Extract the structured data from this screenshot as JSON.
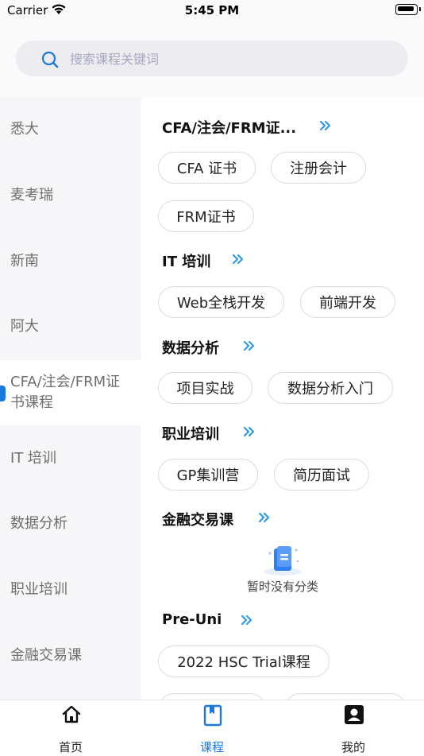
{
  "status_bar": {
    "carrier": "Carrier",
    "time": "5:45 PM"
  },
  "search": {
    "placeholder": "搜索课程关键词"
  },
  "sidebar": {
    "items": [
      {
        "label": "悉大"
      },
      {
        "label": "麦考瑞"
      },
      {
        "label": "新南"
      },
      {
        "label": "阿大"
      },
      {
        "label": "CFA/注会/FRM证书课程",
        "active": true
      },
      {
        "label": "IT 培训"
      },
      {
        "label": "数据分析"
      },
      {
        "label": "职业培训"
      },
      {
        "label": "金融交易课"
      }
    ]
  },
  "categories": [
    {
      "title": "CFA/注会/FRM证...",
      "chips": [
        "CFA 证书",
        "注册会计",
        "FRM证书"
      ]
    },
    {
      "title": "IT 培训",
      "chips": [
        "Web全栈开发",
        "前端开发"
      ]
    },
    {
      "title": "数据分析",
      "chips": [
        "项目实战",
        "数据分析入门"
      ]
    },
    {
      "title": "职业培训",
      "chips": [
        "GP集训营",
        "简历面试"
      ]
    },
    {
      "title": "金融交易课",
      "chips": [],
      "empty_text": "暂时没有分类"
    },
    {
      "title": "Pre-Uni",
      "chips": [
        "2022 HSC Trial课程"
      ]
    }
  ],
  "tabbar": {
    "tabs": [
      {
        "label": "首页",
        "icon": "home-icon"
      },
      {
        "label": "课程",
        "icon": "book-icon",
        "active": true
      },
      {
        "label": "我的",
        "icon": "profile-icon"
      }
    ]
  },
  "colors": {
    "accent": "#1a78e0",
    "arrow": "#2e9be6",
    "chip_border": "#dcdcdc"
  }
}
